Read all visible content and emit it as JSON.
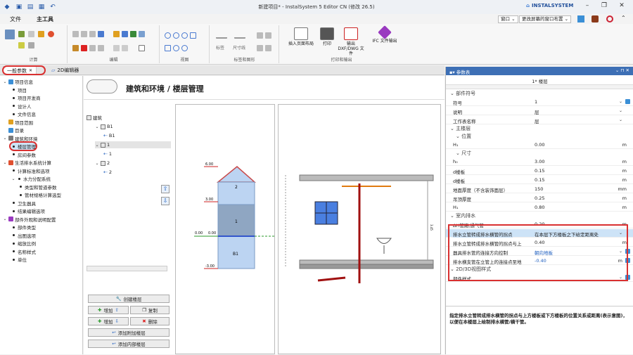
{
  "window": {
    "title": "新建项目* - InstalSystem 5 Editor CN (修改 26.5)",
    "brand": "INSTALSYSTEM",
    "qa_icons": [
      "app-logo-icon",
      "save-icon",
      "folder-icon",
      "print-icon",
      "undo-icon",
      "redo-icon"
    ]
  },
  "menu": {
    "file": "文件",
    "home": "主工具",
    "window_btn": "窗口 ⌄",
    "layout_btn": "更改屏幕的窗口布置 ⌄"
  },
  "ribbon": {
    "groups": [
      "计算",
      "编辑",
      "视图",
      "标签和图形",
      "打印和输出"
    ],
    "small_labels": [
      "标签",
      "尺寸线"
    ],
    "big_buttons": [
      "插入页面布局",
      "打印",
      "输出 DXF/DWG 文件",
      "IFC 文件输出"
    ]
  },
  "tabs": {
    "general": "一般参数",
    "editor2d": "2D编辑器"
  },
  "tree": [
    {
      "label": "项目信息",
      "expanded": true
    },
    {
      "label": "项目",
      "child": true
    },
    {
      "label": "项目开发商",
      "child": true
    },
    {
      "label": "设计人",
      "child": true
    },
    {
      "label": "文件信息",
      "child": true
    },
    {
      "label": "项目范围"
    },
    {
      "label": "目录"
    },
    {
      "label": "建筑和环境",
      "expanded": true
    },
    {
      "label": "楼层管理",
      "child": true,
      "selected": true
    },
    {
      "label": "房间参数",
      "child": true
    },
    {
      "label": "生活排水系统计算",
      "expanded": true
    },
    {
      "label": "计算标准和选项",
      "child": true
    },
    {
      "label": "水力分配系统",
      "child": true,
      "expanded": true
    },
    {
      "label": "类型和管道参数",
      "child2": true
    },
    {
      "label": "管材规格计算选型",
      "child2": true
    },
    {
      "label": "卫生器具",
      "child": true
    },
    {
      "label": "结果编辑选项",
      "child": true
    },
    {
      "label": "部件外观和说明配置",
      "expanded": true
    },
    {
      "label": "部件类型",
      "child": true
    },
    {
      "label": "出图选项",
      "child": true
    },
    {
      "label": "缩放比例",
      "child": true
    },
    {
      "label": "名称样式",
      "child": true
    },
    {
      "label": "单位",
      "child": true
    }
  ],
  "editor": {
    "title": "建筑和环境 / 楼层管理",
    "floors_label": "楼层",
    "floor_tree": [
      {
        "label": "建筑",
        "lvl": 0
      },
      {
        "label": "B1",
        "lvl": 1
      },
      {
        "label": "B1",
        "lvl": 2
      },
      {
        "label": "1",
        "lvl": 1
      },
      {
        "label": "1",
        "lvl": 2
      },
      {
        "label": "2",
        "lvl": 1
      },
      {
        "label": "2",
        "lvl": 2
      }
    ],
    "buttons": {
      "create": "创建楼层",
      "add_up": "增加",
      "copy": "复制",
      "add_down": "增加",
      "delete": "删除",
      "add_extra": "添加附加楼层",
      "add_internal": "添加内部楼层"
    },
    "diagram": {
      "levels": [
        "6.00",
        "3.00",
        "0.00",
        "0.00",
        "-3.00"
      ],
      "floors": [
        "2",
        "1",
        "B1"
      ]
    },
    "sidebar_mark": "3.45"
  },
  "props": {
    "title": "参数表",
    "floor": "1* 楼层",
    "sections": {
      "component_symbol": "部件符号",
      "main_floor": "主楼层",
      "position": "位置",
      "size": "尺寸",
      "indoor_drain": "室内排水",
      "view_style": "2D/3D视图样式"
    },
    "rows": [
      {
        "label": "符号",
        "value": "1",
        "unit": ""
      },
      {
        "label": "说明",
        "value": "层",
        "unit": ""
      },
      {
        "label": "工作表名称",
        "value": "层",
        "unit": ""
      },
      {
        "label": "H₁",
        "value": "0.00",
        "unit": "m"
      },
      {
        "label": "h₀",
        "value": "3.00",
        "unit": "m"
      },
      {
        "label": "d楼板",
        "value": "0.15",
        "unit": "m"
      },
      {
        "label": "d楼板",
        "value": "0.15",
        "unit": "m"
      },
      {
        "label": "地面厚度（不含装饰面层）",
        "value": "150",
        "unit": "mm"
      },
      {
        "label": "吊顶厚度",
        "value": "0.25",
        "unit": "m"
      },
      {
        "label": "H₁",
        "value": "0.80",
        "unit": "m"
      },
      {
        "label": "ΔH管路,通气管",
        "value": "0.20",
        "unit": "m"
      },
      {
        "label": "排水立管转成排水横管的拐点",
        "value": "在本层下方楼板之下给定距离处",
        "unit": ""
      },
      {
        "label": "排水立管转成排水横管的拐点与上",
        "value": "0.40",
        "unit": "m"
      },
      {
        "label": "器具排水管的连接方向控制",
        "value": "朝向地板",
        "unit": ""
      },
      {
        "label": "排水横支管在立管上的连接点至地",
        "value": "-0.40",
        "unit": "m"
      },
      {
        "label": "部件样式",
        "value": "",
        "unit": ""
      }
    ],
    "description": "指定排水立管转成排水横管的拐点与上方楼板或下方楼板的位置关系或距离(表示意图)，以便在本楼层上绘制排水横管/横干管。"
  },
  "colors": {
    "accent": "#1f5fbf",
    "title_bar": "#3d6fb5",
    "highlight": "#d93030",
    "floor_fill": "#bcd4f2",
    "pipe": "#a01010"
  }
}
